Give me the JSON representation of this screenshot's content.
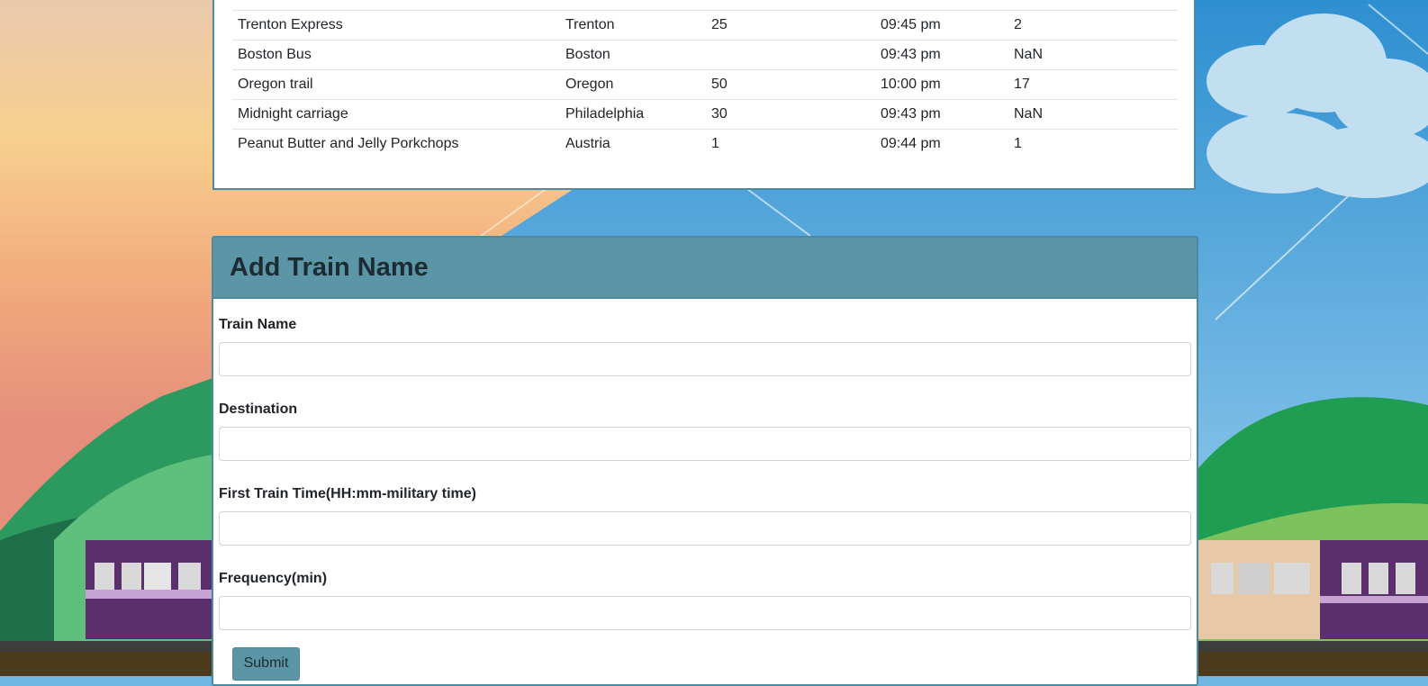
{
  "schedule": {
    "rows": [
      {
        "name": "",
        "destination": "",
        "frequency": "",
        "next_arrival": "",
        "minutes_away": ""
      },
      {
        "name": "Trenton Express",
        "destination": "Trenton",
        "frequency": "25",
        "next_arrival": "09:45 pm",
        "minutes_away": "2"
      },
      {
        "name": "Boston Bus",
        "destination": "Boston",
        "frequency": "",
        "next_arrival": "09:43 pm",
        "minutes_away": "NaN"
      },
      {
        "name": "Oregon trail",
        "destination": "Oregon",
        "frequency": "50",
        "next_arrival": "10:00 pm",
        "minutes_away": "17"
      },
      {
        "name": "Midnight carriage",
        "destination": "Philadelphia",
        "frequency": "30",
        "next_arrival": "09:43 pm",
        "minutes_away": "NaN"
      },
      {
        "name": "Peanut Butter and Jelly Porkchops",
        "destination": "Austria",
        "frequency": "1",
        "next_arrival": "09:44 pm",
        "minutes_away": "1"
      }
    ]
  },
  "form": {
    "title": "Add Train Name",
    "train_name_label": "Train Name",
    "train_name_value": "",
    "destination_label": "Destination",
    "destination_value": "",
    "first_time_label": "First Train Time(HH:mm-military time)",
    "first_time_value": "",
    "frequency_label": "Frequency(min)",
    "frequency_value": "",
    "submit_label": "Submit"
  },
  "colors": {
    "panel_header": "#5b95a6",
    "panel_border": "#4c8aa0",
    "sky": "#6fb6e3",
    "sunset": "#f4c98f"
  }
}
